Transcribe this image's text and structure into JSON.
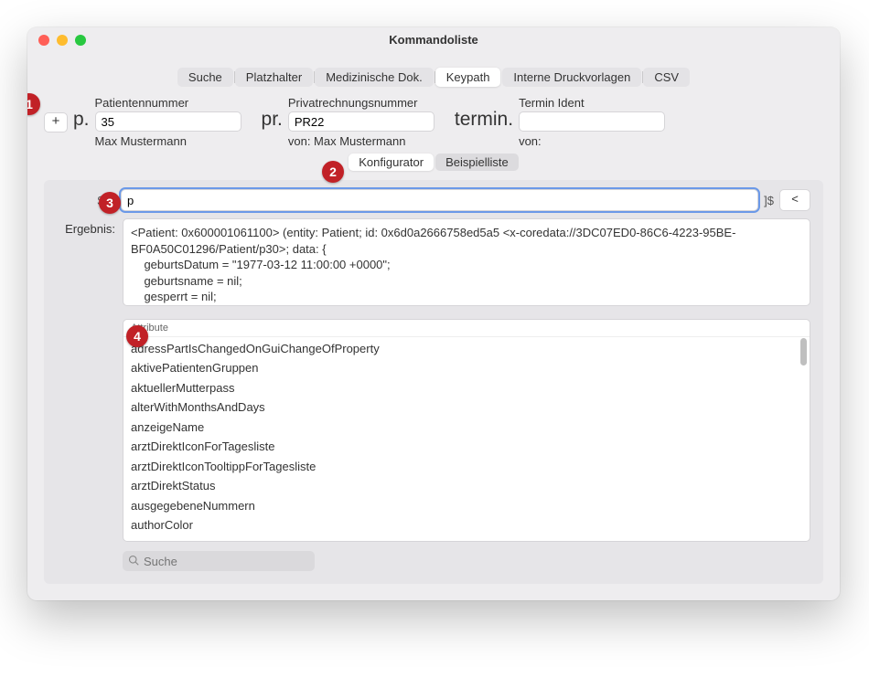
{
  "window": {
    "title": "Kommandoliste"
  },
  "tabs": {
    "items": [
      "Suche",
      "Platzhalter",
      "Medizinische Dok.",
      "Keypath",
      "Interne Druckvorlagen",
      "CSV"
    ],
    "active": "Keypath"
  },
  "plus_label": "+",
  "fields": {
    "patient": {
      "prefix": "p.",
      "label": "Patientennummer",
      "value": "35",
      "sub": "Max Mustermann"
    },
    "invoice": {
      "prefix": "pr.",
      "label": "Privatrechnungsnummer",
      "value": "PR22",
      "sub": "von:   Max Mustermann"
    },
    "termin": {
      "prefix": "termin.",
      "label": "Termin Ident",
      "value": "",
      "sub": "von:"
    }
  },
  "subtabs": {
    "items": [
      "Konfigurator",
      "Beispielliste"
    ],
    "active": "Konfigurator"
  },
  "keypath": {
    "prefix": "$[&",
    "value": "p",
    "suffix": "]$",
    "back": "<"
  },
  "result": {
    "label": "Ergebnis:",
    "text": "<Patient: 0x600001061100> (entity: Patient; id: 0x6d0a2666758ed5a5 <x-coredata://3DC07ED0-86C6-4223-95BE-BF0A50C01296/Patient/p30>; data: {\n    geburtsDatum = \"1977-03-12 11:00:00 +0000\";\n    geburtsname = nil;\n    gesperrt = nil;"
  },
  "attributes": {
    "header": "Attribute",
    "items": [
      "adressPartIsChangedOnGuiChangeOfProperty",
      "aktivePatientenGruppen",
      "aktuellerMutterpass",
      "alterWithMonthsAndDays",
      "anzeigeName",
      "arztDirektIconForTagesliste",
      "arztDirektIconTooltippForTagesliste",
      "arztDirektStatus",
      "ausgegebeneNummern",
      "authorColor"
    ]
  },
  "search": {
    "placeholder": "Suche"
  },
  "badges": {
    "b1": "1",
    "b2": "2",
    "b3": "3",
    "b4": "4"
  }
}
